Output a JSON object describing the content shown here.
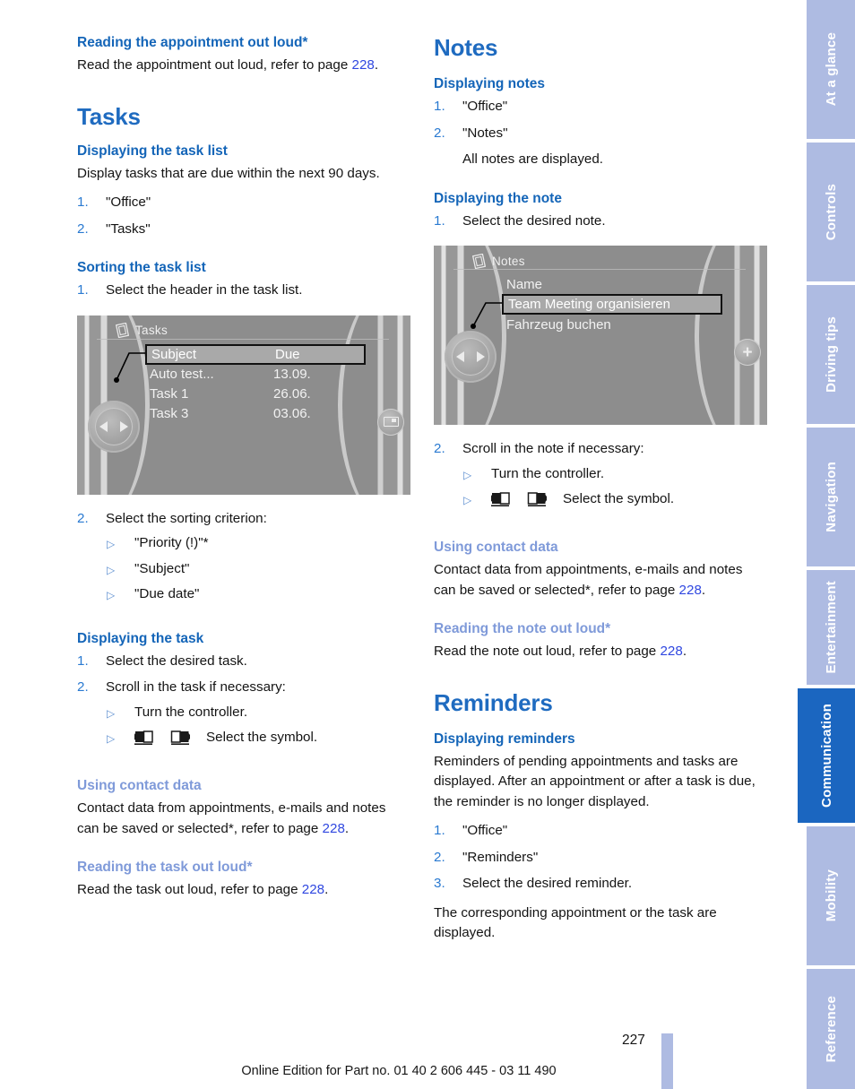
{
  "colors": {
    "heading_blue": "#1465b8",
    "chapter_blue": "#1f6bc0",
    "soft_heading_blue": "#7f9ad9",
    "page_ref_blue": "#2f47e0",
    "list_num_blue": "#2a7ad1",
    "tab_inactive": "#aebbe2",
    "tab_active": "#1b66c0"
  },
  "left_column": {
    "appointment_aloud": {
      "heading": "Reading the appointment out loud*",
      "body_before": "Read the appointment out loud, refer to page ",
      "page_ref": "228",
      "body_after": "."
    },
    "tasks_chapter": "Tasks",
    "displaying_task_list": {
      "heading": "Displaying the task list",
      "intro": "Display tasks that are due within the next 90 days.",
      "steps": [
        {
          "num": "1.",
          "text": "\"Office\""
        },
        {
          "num": "2.",
          "text": "\"Tasks\""
        }
      ]
    },
    "sorting_task_list": {
      "heading": "Sorting the task list",
      "steps": [
        {
          "num": "1.",
          "text": "Select the header in the task list."
        }
      ],
      "step2": {
        "num": "2.",
        "text": "Select the sorting criterion:"
      },
      "criteria": [
        "\"Priority (!)\"*",
        "\"Subject\"",
        "\"Due date\""
      ]
    },
    "displaying_task": {
      "heading": "Displaying the task",
      "steps": [
        {
          "num": "1.",
          "text": "Select the desired task."
        },
        {
          "num": "2.",
          "text": "Scroll in the task if necessary:"
        }
      ],
      "substeps": [
        {
          "text": "Turn the controller.",
          "has_symbols": false
        },
        {
          "text": "Select the symbol.",
          "has_symbols": true
        }
      ]
    },
    "using_contact_data": {
      "heading": "Using contact data",
      "body_before": "Contact data from appointments, e-mails and notes can be saved or selected*, refer to page ",
      "page_ref": "228",
      "body_after": "."
    },
    "reading_task_aloud": {
      "heading": "Reading the task out loud*",
      "body_before": "Read the task out loud, refer to page ",
      "page_ref": "228",
      "body_after": "."
    },
    "tasks_screen": {
      "title": "Tasks",
      "header": {
        "col1": "Subject",
        "col2": "Due"
      },
      "rows": [
        {
          "col1": "Auto test...",
          "col2": "13.09."
        },
        {
          "col1": "Task 1",
          "col2": "26.06."
        },
        {
          "col1": "Task 3",
          "col2": "03.06."
        }
      ],
      "side_button_icon": "chip-card-icon"
    }
  },
  "right_column": {
    "notes_chapter": "Notes",
    "displaying_notes": {
      "heading": "Displaying notes",
      "steps": [
        {
          "num": "1.",
          "text": "\"Office\""
        },
        {
          "num": "2.",
          "text": "\"Notes\""
        }
      ],
      "trailing": "All notes are displayed."
    },
    "displaying_note": {
      "heading": "Displaying the note",
      "steps": [
        {
          "num": "1.",
          "text": "Select the desired note."
        }
      ],
      "step2": {
        "num": "2.",
        "text": "Scroll in the note if necessary:"
      },
      "substeps": [
        {
          "text": "Turn the controller.",
          "has_symbols": false
        },
        {
          "text": "Select the symbol.",
          "has_symbols": true
        }
      ]
    },
    "using_contact_data": {
      "heading": "Using contact data",
      "body_before": "Contact data from appointments, e-mails and notes can be saved or selected*, refer to page ",
      "page_ref": "228",
      "body_after": "."
    },
    "reading_note_aloud": {
      "heading": "Reading the note out loud*",
      "body_before": "Read the note out loud, refer to page ",
      "page_ref": "228",
      "body_after": "."
    },
    "reminders_chapter": "Reminders",
    "displaying_reminders": {
      "heading": "Displaying reminders",
      "intro": "Reminders of pending appointments and tasks are displayed. After an appointment or after a task is due, the reminder is no longer displayed.",
      "steps": [
        {
          "num": "1.",
          "text": "\"Office\""
        },
        {
          "num": "2.",
          "text": "\"Reminders\""
        },
        {
          "num": "3.",
          "text": "Select the desired reminder."
        }
      ],
      "outro": "The corresponding appointment or the task are displayed."
    },
    "notes_screen": {
      "title": "Notes",
      "header": {
        "col1": "Name"
      },
      "rows": [
        {
          "col1": "Team Meeting organisieren",
          "highlighted": true
        },
        {
          "col1": "Fahrzeug buchen",
          "highlighted": false
        }
      ],
      "side_button_icon": "plus-icon"
    }
  },
  "rail": {
    "tabs": [
      {
        "label": "At a glance",
        "active": false
      },
      {
        "label": "Controls",
        "active": false
      },
      {
        "label": "Driving tips",
        "active": false
      },
      {
        "label": "Navigation",
        "active": false
      },
      {
        "label": "Entertainment",
        "active": false
      },
      {
        "label": "Communication",
        "active": true
      },
      {
        "label": "Mobility",
        "active": false
      },
      {
        "label": "Reference",
        "active": false
      }
    ]
  },
  "footer": {
    "online_edition": "Online Edition for Part no. 01 40 2 606 445 - 03 11 490",
    "page_number": "227"
  }
}
